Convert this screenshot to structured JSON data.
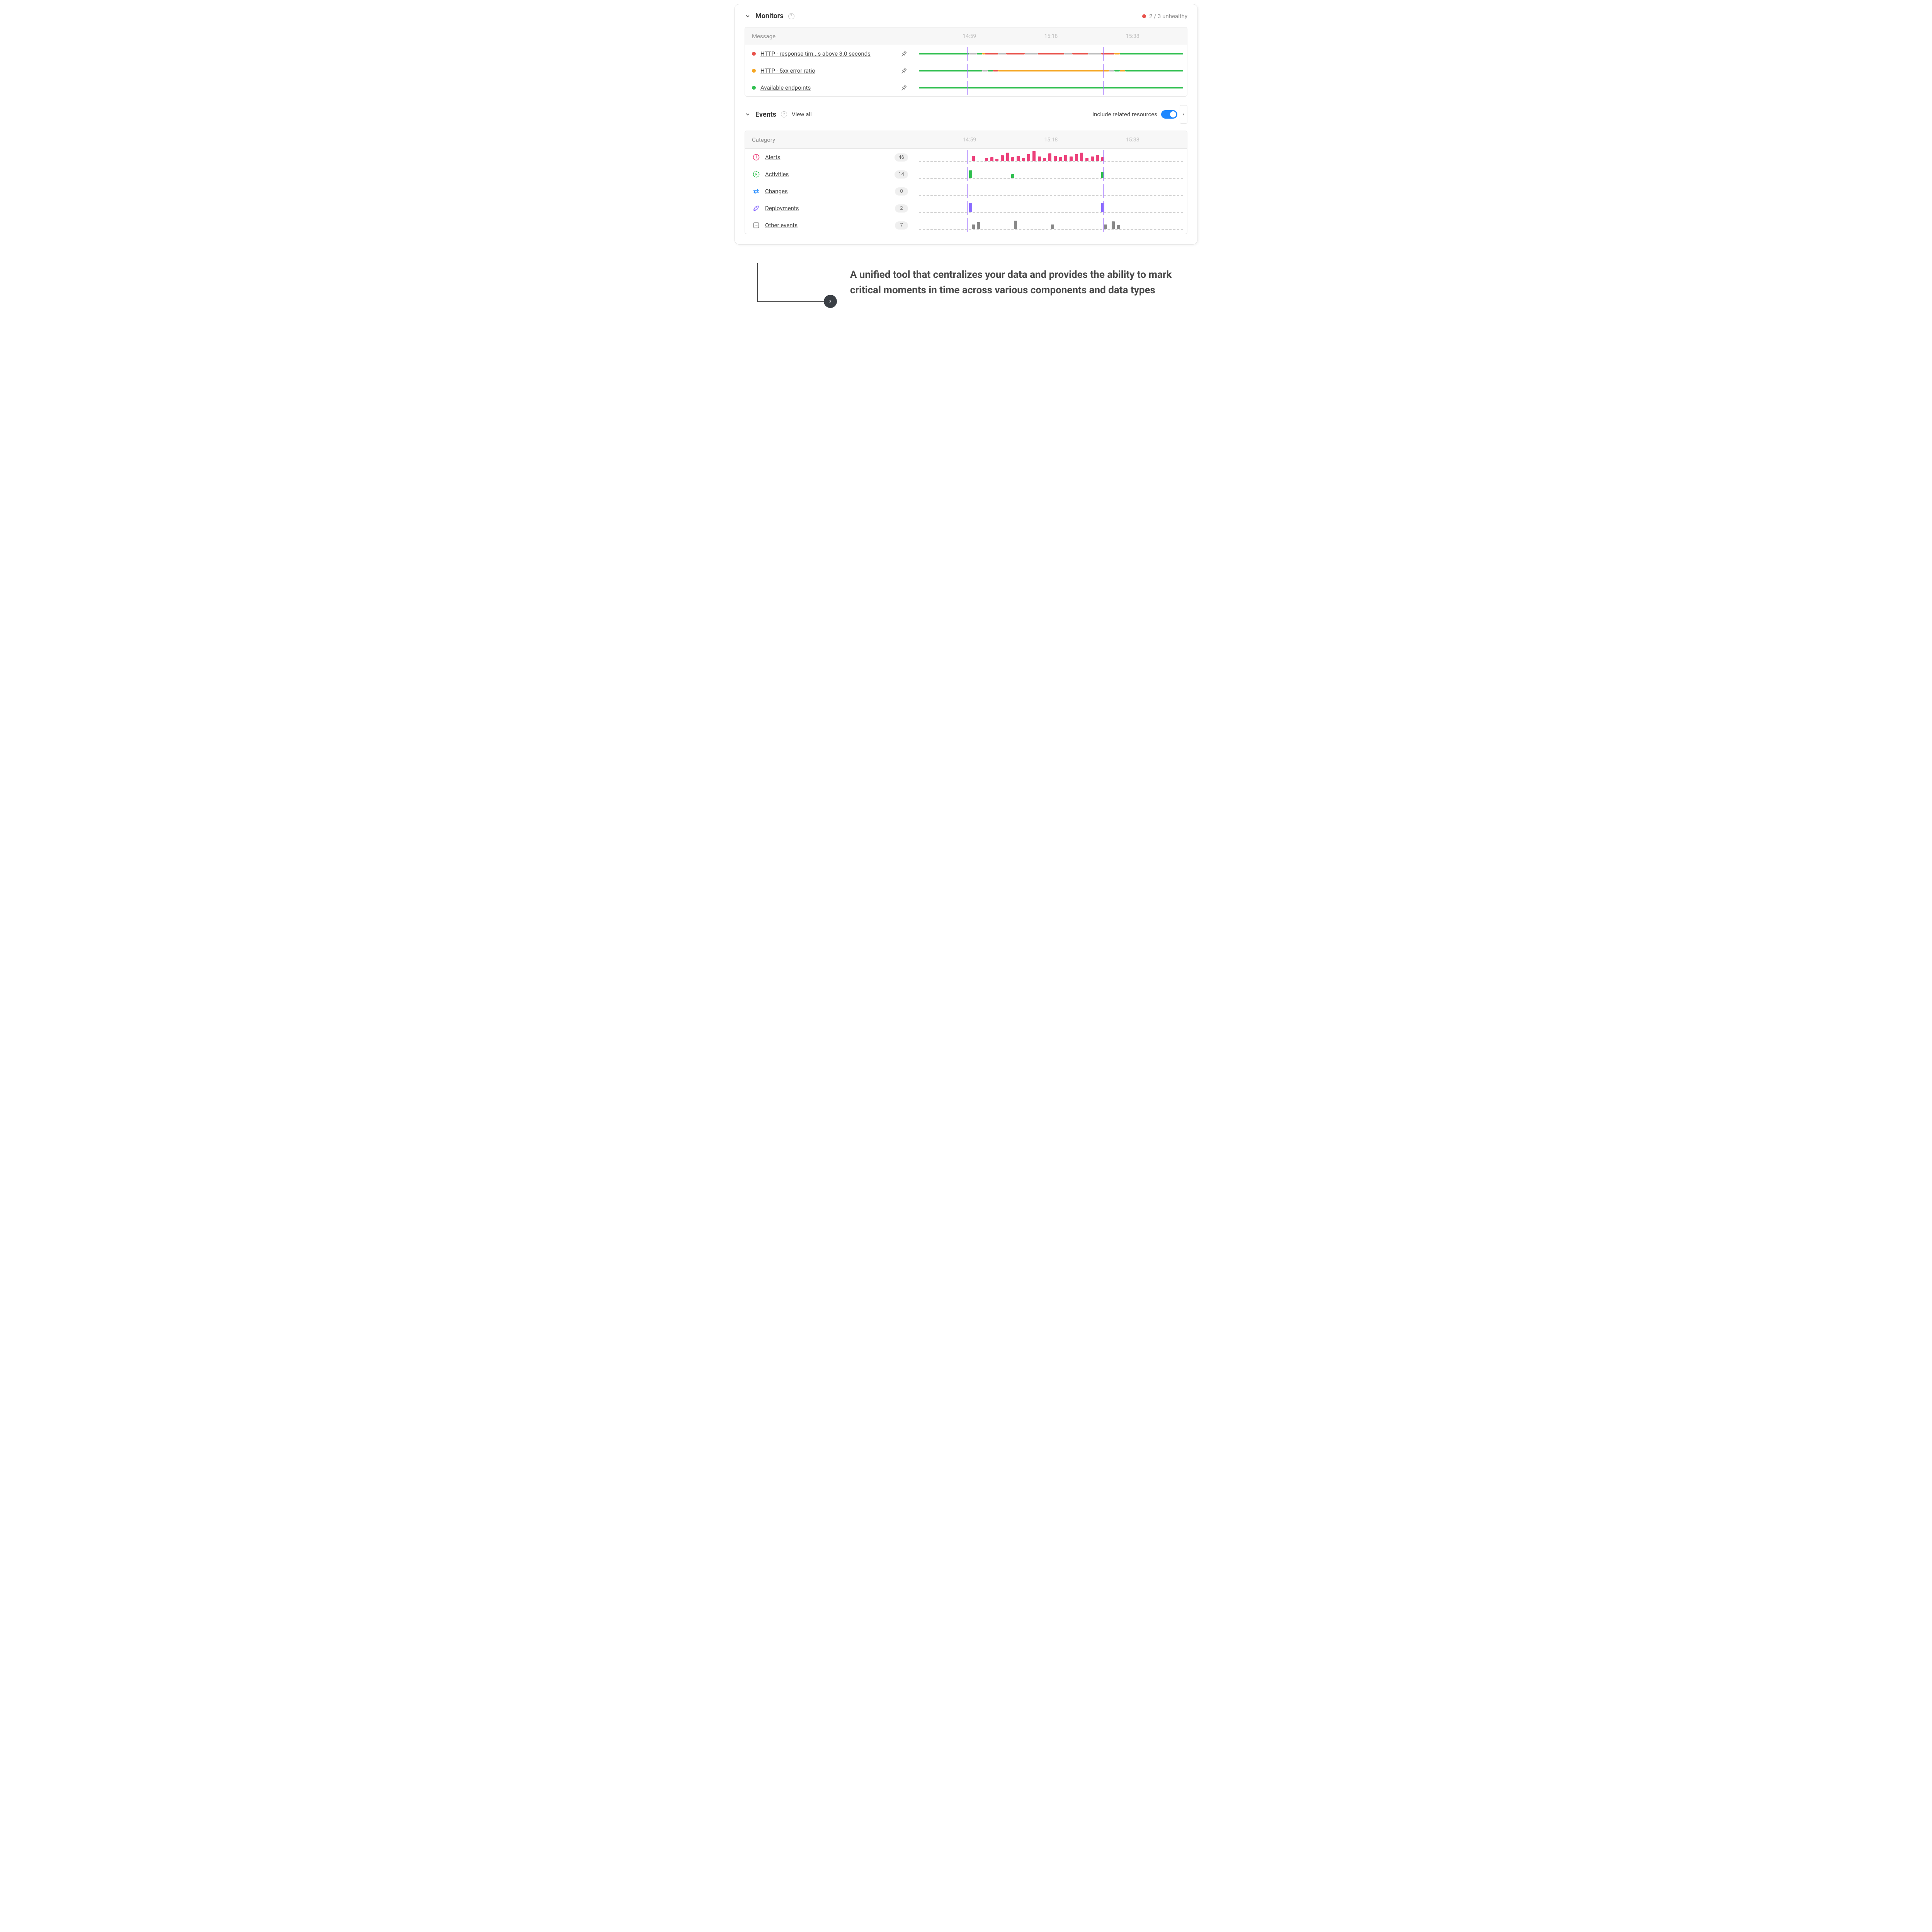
{
  "timeline": {
    "ticks": [
      "14:59",
      "15:18",
      "15:38"
    ],
    "tick_positions_pct": [
      20,
      50,
      80
    ],
    "marker_positions_pct": [
      19,
      69
    ]
  },
  "monitors": {
    "title": "Monitors",
    "headCol": "Message",
    "health": {
      "text": "2 / 3 unhealthy",
      "color": "#e8514a"
    },
    "rows": [
      {
        "name": "http-response-time",
        "color": "#e8514a",
        "label": "HTTP - response tim...s above 3.0 seconds",
        "pinned_icon": true,
        "segments": [
          {
            "from": 0,
            "to": 19,
            "color": "#2fbf4f"
          },
          {
            "from": 19,
            "to": 22,
            "color": "#bdbdbd"
          },
          {
            "from": 22,
            "to": 24,
            "color": "#2fbf4f"
          },
          {
            "from": 24,
            "to": 25,
            "color": "#f5a623"
          },
          {
            "from": 25,
            "to": 30,
            "color": "#e8514a"
          },
          {
            "from": 30,
            "to": 33,
            "color": "#bdbdbd"
          },
          {
            "from": 33,
            "to": 40,
            "color": "#e8514a"
          },
          {
            "from": 40,
            "to": 45,
            "color": "#bdbdbd"
          },
          {
            "from": 45,
            "to": 55,
            "color": "#e8514a"
          },
          {
            "from": 55,
            "to": 58,
            "color": "#bdbdbd"
          },
          {
            "from": 58,
            "to": 64,
            "color": "#e8514a"
          },
          {
            "from": 64,
            "to": 69,
            "color": "#bdbdbd"
          },
          {
            "from": 69,
            "to": 74,
            "color": "#e8514a"
          },
          {
            "from": 74,
            "to": 76,
            "color": "#f5a623"
          },
          {
            "from": 76,
            "to": 100,
            "color": "#2fbf4f"
          }
        ]
      },
      {
        "name": "http-5xx-ratio",
        "color": "#f5a623",
        "label": "HTTP - 5xx error ratio",
        "pinned_icon": true,
        "segments": [
          {
            "from": 0,
            "to": 24,
            "color": "#2fbf4f"
          },
          {
            "from": 24,
            "to": 26,
            "color": "#bdbdbd"
          },
          {
            "from": 26,
            "to": 28,
            "color": "#2fbf4f"
          },
          {
            "from": 28,
            "to": 30,
            "color": "#e8514a"
          },
          {
            "from": 30,
            "to": 72,
            "color": "#f5a623"
          },
          {
            "from": 72,
            "to": 74,
            "color": "#bdbdbd"
          },
          {
            "from": 74,
            "to": 76,
            "color": "#2fbf4f"
          },
          {
            "from": 76,
            "to": 78,
            "color": "#f5a623"
          },
          {
            "from": 78,
            "to": 100,
            "color": "#2fbf4f"
          }
        ]
      },
      {
        "name": "available-endpoints",
        "color": "#2fbf4f",
        "label": "Available endpoints",
        "pinned_icon": true,
        "segments": [
          {
            "from": 0,
            "to": 100,
            "color": "#2fbf4f"
          }
        ]
      }
    ]
  },
  "events": {
    "title": "Events",
    "viewAll": "View all",
    "includeRelated": "Include related resources",
    "toggleOn": true,
    "headCol": "Category",
    "rows": [
      {
        "name": "alerts",
        "icon": "alert-icon",
        "iconColor": "#ec407a",
        "label": "Alerts",
        "count": 46,
        "barsColor": "#ec407a",
        "bars": [
          {
            "x": 20,
            "h": 14
          },
          {
            "x": 25,
            "h": 8
          },
          {
            "x": 27,
            "h": 10
          },
          {
            "x": 29,
            "h": 6
          },
          {
            "x": 31,
            "h": 15
          },
          {
            "x": 33,
            "h": 22
          },
          {
            "x": 35,
            "h": 10
          },
          {
            "x": 37,
            "h": 14
          },
          {
            "x": 39,
            "h": 8
          },
          {
            "x": 41,
            "h": 18
          },
          {
            "x": 43,
            "h": 26
          },
          {
            "x": 45,
            "h": 12
          },
          {
            "x": 47,
            "h": 8
          },
          {
            "x": 49,
            "h": 20
          },
          {
            "x": 51,
            "h": 14
          },
          {
            "x": 53,
            "h": 10
          },
          {
            "x": 55,
            "h": 16
          },
          {
            "x": 57,
            "h": 12
          },
          {
            "x": 59,
            "h": 18
          },
          {
            "x": 61,
            "h": 22
          },
          {
            "x": 63,
            "h": 8
          },
          {
            "x": 65,
            "h": 12
          },
          {
            "x": 67,
            "h": 16
          },
          {
            "x": 69,
            "h": 10
          }
        ]
      },
      {
        "name": "activities",
        "icon": "activity-icon",
        "iconColor": "#2fbf4f",
        "label": "Activities",
        "count": 14,
        "barsColor": "#2fbf4f",
        "bars": [
          {
            "x": 19,
            "h": 20
          },
          {
            "x": 35,
            "h": 10
          },
          {
            "x": 69,
            "h": 16
          }
        ]
      },
      {
        "name": "changes",
        "icon": "changes-icon",
        "iconColor": "#1e88ff",
        "label": "Changes",
        "count": 0,
        "barsColor": "#1e88ff",
        "bars": []
      },
      {
        "name": "deployments",
        "icon": "rocket-icon",
        "iconColor": "#8a6cff",
        "label": "Deployments",
        "count": 2,
        "barsColor": "#8a6cff",
        "bars": [
          {
            "x": 19,
            "h": 24
          },
          {
            "x": 69,
            "h": 24
          }
        ]
      },
      {
        "name": "other-events",
        "icon": "more-icon",
        "iconColor": "#888888",
        "label": "Other events",
        "count": 7,
        "barsColor": "#888888",
        "bars": [
          {
            "x": 20,
            "h": 12
          },
          {
            "x": 22,
            "h": 18
          },
          {
            "x": 36,
            "h": 22
          },
          {
            "x": 50,
            "h": 12
          },
          {
            "x": 70,
            "h": 12
          },
          {
            "x": 73,
            "h": 20
          },
          {
            "x": 75,
            "h": 10
          }
        ]
      }
    ]
  },
  "callout": {
    "text": "A unified tool that centralizes your data and provides the ability to mark critical moments in time across various components and data types"
  },
  "chart_data": [
    {
      "type": "bar",
      "title": "Alerts event frequency",
      "x_unit": "percent_of_timeline",
      "y_unit": "relative_height",
      "series": [
        {
          "name": "Alerts",
          "color": "#ec407a",
          "points": [
            {
              "x": 20,
              "y": 14
            },
            {
              "x": 25,
              "y": 8
            },
            {
              "x": 27,
              "y": 10
            },
            {
              "x": 29,
              "y": 6
            },
            {
              "x": 31,
              "y": 15
            },
            {
              "x": 33,
              "y": 22
            },
            {
              "x": 35,
              "y": 10
            },
            {
              "x": 37,
              "y": 14
            },
            {
              "x": 39,
              "y": 8
            },
            {
              "x": 41,
              "y": 18
            },
            {
              "x": 43,
              "y": 26
            },
            {
              "x": 45,
              "y": 12
            },
            {
              "x": 47,
              "y": 8
            },
            {
              "x": 49,
              "y": 20
            },
            {
              "x": 51,
              "y": 14
            },
            {
              "x": 53,
              "y": 10
            },
            {
              "x": 55,
              "y": 16
            },
            {
              "x": 57,
              "y": 12
            },
            {
              "x": 59,
              "y": 18
            },
            {
              "x": 61,
              "y": 22
            },
            {
              "x": 63,
              "y": 8
            },
            {
              "x": 65,
              "y": 12
            },
            {
              "x": 67,
              "y": 16
            },
            {
              "x": 69,
              "y": 10
            }
          ]
        }
      ],
      "x_ticks": [
        "14:59",
        "15:18",
        "15:38"
      ]
    },
    {
      "type": "bar",
      "title": "Activities event frequency",
      "series": [
        {
          "name": "Activities",
          "color": "#2fbf4f",
          "points": [
            {
              "x": 19,
              "y": 20
            },
            {
              "x": 35,
              "y": 10
            },
            {
              "x": 69,
              "y": 16
            }
          ]
        }
      ],
      "x_ticks": [
        "14:59",
        "15:18",
        "15:38"
      ]
    },
    {
      "type": "bar",
      "title": "Changes event frequency",
      "series": [
        {
          "name": "Changes",
          "color": "#1e88ff",
          "points": []
        }
      ],
      "x_ticks": [
        "14:59",
        "15:18",
        "15:38"
      ]
    },
    {
      "type": "bar",
      "title": "Deployments event frequency",
      "series": [
        {
          "name": "Deployments",
          "color": "#8a6cff",
          "points": [
            {
              "x": 19,
              "y": 24
            },
            {
              "x": 69,
              "y": 24
            }
          ]
        }
      ],
      "x_ticks": [
        "14:59",
        "15:18",
        "15:38"
      ]
    },
    {
      "type": "bar",
      "title": "Other events frequency",
      "series": [
        {
          "name": "Other events",
          "color": "#888888",
          "points": [
            {
              "x": 20,
              "y": 12
            },
            {
              "x": 22,
              "y": 18
            },
            {
              "x": 36,
              "y": 22
            },
            {
              "x": 50,
              "y": 12
            },
            {
              "x": 70,
              "y": 12
            },
            {
              "x": 73,
              "y": 20
            },
            {
              "x": 75,
              "y": 10
            }
          ]
        }
      ],
      "x_ticks": [
        "14:59",
        "15:18",
        "15:38"
      ]
    }
  ]
}
